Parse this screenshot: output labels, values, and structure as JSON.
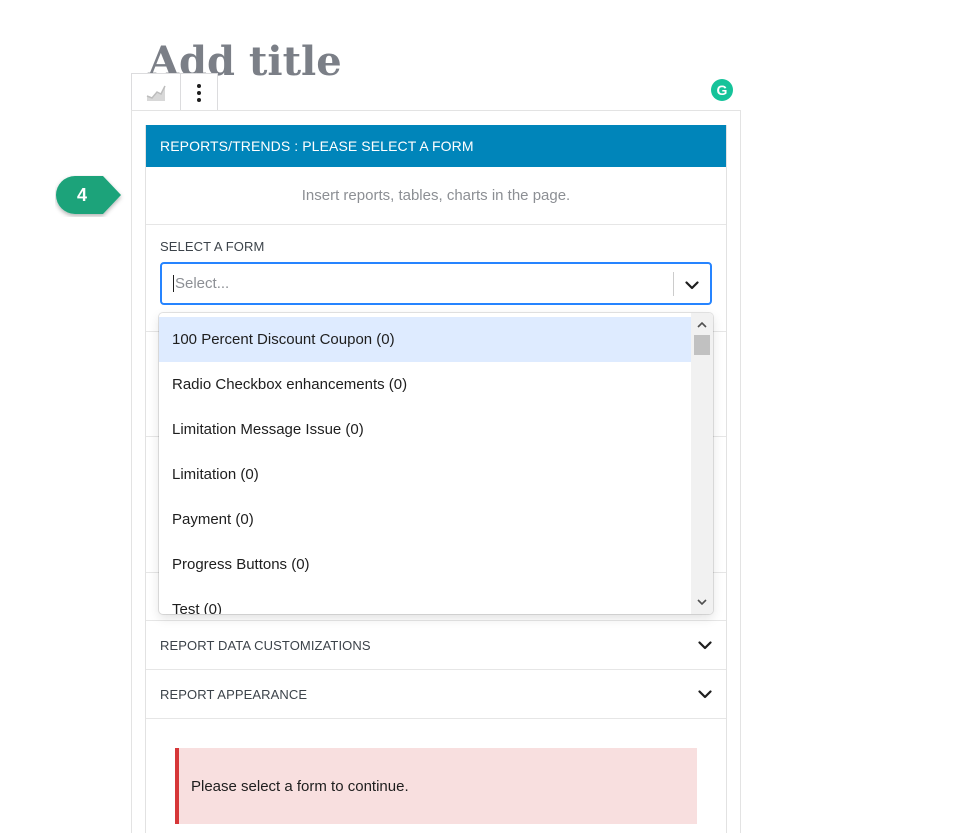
{
  "editor": {
    "post_title": "Add title",
    "grammarly_letter": "G"
  },
  "block": {
    "header_title": "REPORTS/TRENDS : PLEASE SELECT A FORM",
    "subtitle": "Insert reports, tables, charts in the page.",
    "select_form_label": "SELECT A FORM",
    "select_placeholder": "Select...",
    "accordions": [
      {
        "label": "REPORT DATA CUSTOMIZATIONS"
      },
      {
        "label": "REPORT APPEARANCE"
      }
    ],
    "notice": "Please select a form to continue."
  },
  "dropdown": {
    "options": [
      {
        "label": "100 Percent Discount Coupon (0)"
      },
      {
        "label": "Radio Checkbox enhancements (0)"
      },
      {
        "label": "Limitation Message Issue (0)"
      },
      {
        "label": "Limitation (0)"
      },
      {
        "label": "Payment (0)"
      },
      {
        "label": "Progress Buttons (0)"
      },
      {
        "label": "Test (0)"
      }
    ]
  },
  "annotation": {
    "step": "4",
    "color": "#1aa37a"
  },
  "colors": {
    "header_blue": "#0085ba",
    "focus_blue": "#2684ff",
    "option_highlight": "#deebff",
    "notice_bg": "#f8dfdf",
    "notice_border": "#d63638"
  }
}
